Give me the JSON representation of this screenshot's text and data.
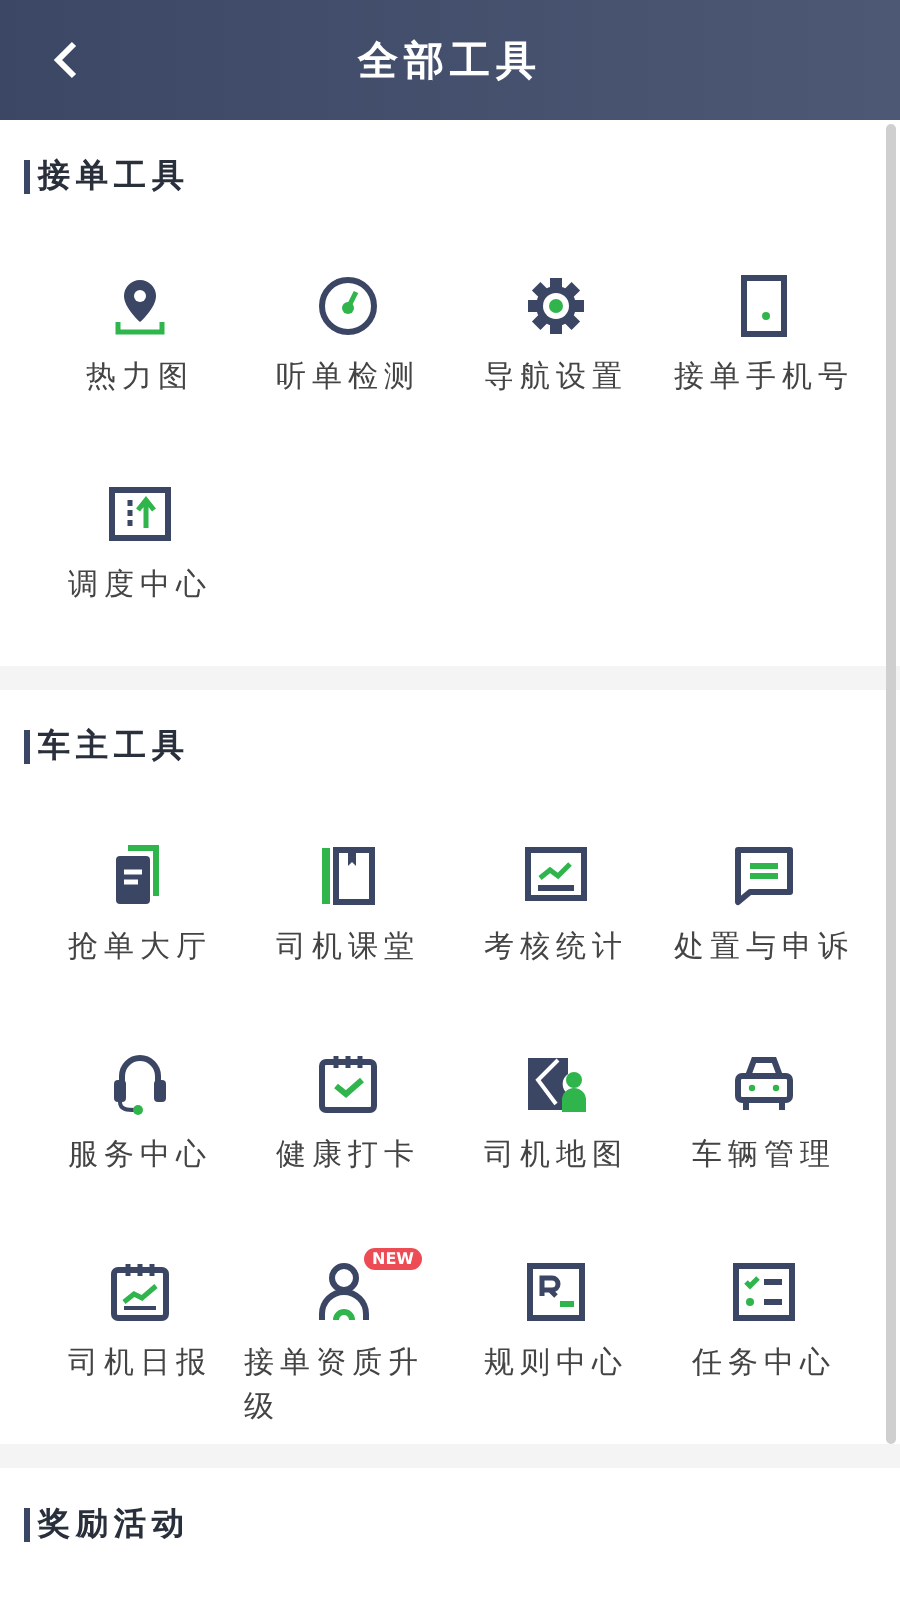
{
  "header": {
    "title": "全部工具"
  },
  "sections": [
    {
      "title": "接单工具",
      "items": [
        {
          "label": "热力图"
        },
        {
          "label": "听单检测"
        },
        {
          "label": "导航设置"
        },
        {
          "label": "接单手机号"
        },
        {
          "label": "调度中心"
        }
      ]
    },
    {
      "title": "车主工具",
      "items": [
        {
          "label": "抢单大厅"
        },
        {
          "label": "司机课堂"
        },
        {
          "label": "考核统计"
        },
        {
          "label": "处置与申诉"
        },
        {
          "label": "服务中心"
        },
        {
          "label": "健康打卡"
        },
        {
          "label": "司机地图"
        },
        {
          "label": "车辆管理"
        },
        {
          "label": "司机日报"
        },
        {
          "label": "接单资质升级",
          "badge": "NEW"
        },
        {
          "label": "规则中心"
        },
        {
          "label": "任务中心"
        }
      ]
    },
    {
      "title": "奖励活动"
    }
  ]
}
